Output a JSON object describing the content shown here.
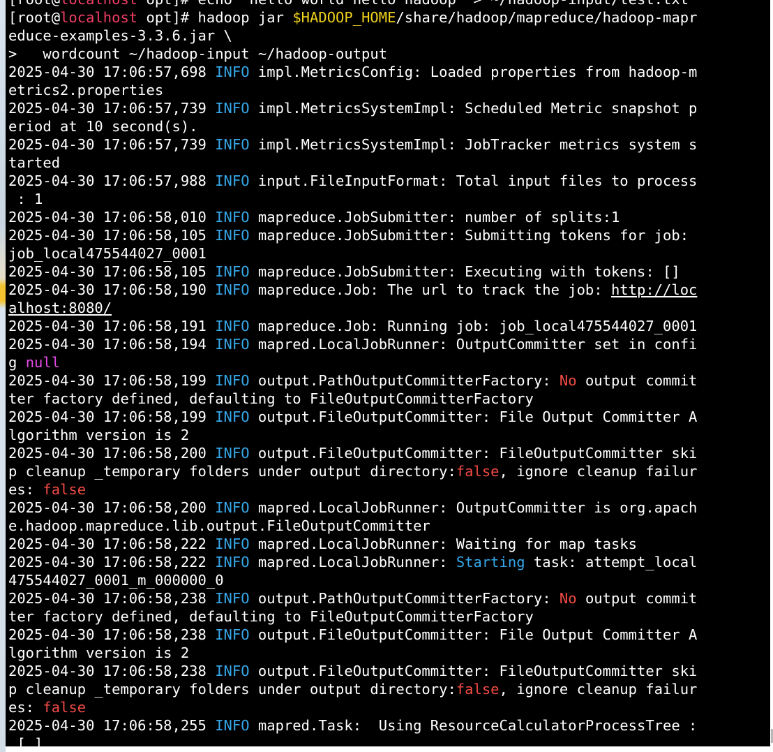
{
  "colors": {
    "terminal_background": "#000000",
    "text": "#ffffff",
    "hostname": "#f33f66",
    "info": "#36a7e8",
    "env_var": "#f0d21d",
    "null_value": "#e64be8",
    "false_value": "#f24b45",
    "no_value": "#f24b45"
  },
  "terminal": {
    "lines": [
      [
        {
          "t": "[root@",
          "c": ""
        },
        {
          "t": "localhost",
          "c": "red"
        },
        {
          "t": " opt]# echo \"hello world hello hadoop\" > ~/hadoop-input/test.txt",
          "c": ""
        }
      ],
      [
        {
          "t": "[root@",
          "c": ""
        },
        {
          "t": "localhost",
          "c": "red"
        },
        {
          "t": " opt]# hadoop jar ",
          "c": ""
        },
        {
          "t": "$HADOOP_HOME",
          "c": "env"
        },
        {
          "t": "/share/hadoop/mapreduce/hadoop-mapr",
          "c": ""
        }
      ],
      [
        {
          "t": "educe-examples-3.3.6.jar \\",
          "c": ""
        }
      ],
      [
        {
          "t": ">   wordcount ~/hadoop-input ~/hadoop-output",
          "c": ""
        }
      ],
      [
        {
          "t": "2025-04-30 17:06:57,698 ",
          "c": ""
        },
        {
          "t": "INFO",
          "c": "info"
        },
        {
          "t": " impl.MetricsConfig: Loaded properties from hadoop-m",
          "c": ""
        }
      ],
      [
        {
          "t": "etrics2.properties",
          "c": ""
        }
      ],
      [
        {
          "t": "2025-04-30 17:06:57,739 ",
          "c": ""
        },
        {
          "t": "INFO",
          "c": "info"
        },
        {
          "t": " impl.MetricsSystemImpl: Scheduled Metric snapshot p",
          "c": ""
        }
      ],
      [
        {
          "t": "eriod at 10 second(s).",
          "c": ""
        }
      ],
      [
        {
          "t": "2025-04-30 17:06:57,739 ",
          "c": ""
        },
        {
          "t": "INFO",
          "c": "info"
        },
        {
          "t": " impl.MetricsSystemImpl: JobTracker metrics system s",
          "c": ""
        }
      ],
      [
        {
          "t": "tarted",
          "c": ""
        }
      ],
      [
        {
          "t": "2025-04-30 17:06:57,988 ",
          "c": ""
        },
        {
          "t": "INFO",
          "c": "info"
        },
        {
          "t": " input.FileInputFormat: Total input files to process",
          "c": ""
        }
      ],
      [
        {
          "t": " : 1",
          "c": ""
        }
      ],
      [
        {
          "t": "2025-04-30 17:06:58,010 ",
          "c": ""
        },
        {
          "t": "INFO",
          "c": "info"
        },
        {
          "t": " mapreduce.JobSubmitter: number of splits:1",
          "c": ""
        }
      ],
      [
        {
          "t": "2025-04-30 17:06:58,105 ",
          "c": ""
        },
        {
          "t": "INFO",
          "c": "info"
        },
        {
          "t": " mapreduce.JobSubmitter: Submitting tokens for job:",
          "c": ""
        }
      ],
      [
        {
          "t": "job_local475544027_0001",
          "c": ""
        }
      ],
      [
        {
          "t": "2025-04-30 17:06:58,105 ",
          "c": ""
        },
        {
          "t": "INFO",
          "c": "info"
        },
        {
          "t": " mapreduce.JobSubmitter: Executing with tokens: []",
          "c": ""
        }
      ],
      [
        {
          "t": "2025-04-30 17:06:58,190 ",
          "c": ""
        },
        {
          "t": "INFO",
          "c": "info"
        },
        {
          "t": " mapreduce.Job: The url to track the job: ",
          "c": ""
        },
        {
          "t": "http://loc",
          "c": "link"
        }
      ],
      [
        {
          "t": "alhost:8080/",
          "c": "link"
        }
      ],
      [
        {
          "t": "2025-04-30 17:06:58,191 ",
          "c": ""
        },
        {
          "t": "INFO",
          "c": "info"
        },
        {
          "t": " mapreduce.Job: Running job: job_local475544027_0001",
          "c": ""
        }
      ],
      [
        {
          "t": "2025-04-30 17:06:58,194 ",
          "c": ""
        },
        {
          "t": "INFO",
          "c": "info"
        },
        {
          "t": " mapred.LocalJobRunner: OutputCommitter set in confi",
          "c": ""
        }
      ],
      [
        {
          "t": "g ",
          "c": ""
        },
        {
          "t": "null",
          "c": "magenta"
        }
      ],
      [
        {
          "t": "2025-04-30 17:06:58,199 ",
          "c": ""
        },
        {
          "t": "INFO",
          "c": "info"
        },
        {
          "t": " output.PathOutputCommitterFactory: ",
          "c": ""
        },
        {
          "t": "No",
          "c": "err"
        },
        {
          "t": " output commit",
          "c": ""
        }
      ],
      [
        {
          "t": "ter factory defined, defaulting to FileOutputCommitterFactory",
          "c": ""
        }
      ],
      [
        {
          "t": "2025-04-30 17:06:58,199 ",
          "c": ""
        },
        {
          "t": "INFO",
          "c": "info"
        },
        {
          "t": " output.FileOutputCommitter: File Output Committer A",
          "c": ""
        }
      ],
      [
        {
          "t": "lgorithm version is 2",
          "c": ""
        }
      ],
      [
        {
          "t": "2025-04-30 17:06:58,200 ",
          "c": ""
        },
        {
          "t": "INFO",
          "c": "info"
        },
        {
          "t": " output.FileOutputCommitter: FileOutputCommitter ski",
          "c": ""
        }
      ],
      [
        {
          "t": "p cleanup _temporary folders under output directory:",
          "c": ""
        },
        {
          "t": "false",
          "c": "err"
        },
        {
          "t": ", ignore cleanup failur",
          "c": ""
        }
      ],
      [
        {
          "t": "es: ",
          "c": ""
        },
        {
          "t": "false",
          "c": "err"
        }
      ],
      [
        {
          "t": "2025-04-30 17:06:58,200 ",
          "c": ""
        },
        {
          "t": "INFO",
          "c": "info"
        },
        {
          "t": " mapred.LocalJobRunner: OutputCommitter is org.apach",
          "c": ""
        }
      ],
      [
        {
          "t": "e.hadoop.mapreduce.lib.output.FileOutputCommitter",
          "c": ""
        }
      ],
      [
        {
          "t": "2025-04-30 17:06:58,222 ",
          "c": ""
        },
        {
          "t": "INFO",
          "c": "info"
        },
        {
          "t": " mapred.LocalJobRunner: Waiting for map tasks",
          "c": ""
        }
      ],
      [
        {
          "t": "2025-04-30 17:06:58,222 ",
          "c": ""
        },
        {
          "t": "INFO",
          "c": "info"
        },
        {
          "t": " mapred.LocalJobRunner: ",
          "c": ""
        },
        {
          "t": "Starting",
          "c": "start"
        },
        {
          "t": " task: attempt_local",
          "c": ""
        }
      ],
      [
        {
          "t": "475544027_0001_m_000000_0",
          "c": ""
        }
      ],
      [
        {
          "t": "2025-04-30 17:06:58,238 ",
          "c": ""
        },
        {
          "t": "INFO",
          "c": "info"
        },
        {
          "t": " output.PathOutputCommitterFactory: ",
          "c": ""
        },
        {
          "t": "No",
          "c": "err"
        },
        {
          "t": " output commit",
          "c": ""
        }
      ],
      [
        {
          "t": "ter factory defined, defaulting to FileOutputCommitterFactory",
          "c": ""
        }
      ],
      [
        {
          "t": "2025-04-30 17:06:58,238 ",
          "c": ""
        },
        {
          "t": "INFO",
          "c": "info"
        },
        {
          "t": " output.FileOutputCommitter: File Output Committer A",
          "c": ""
        }
      ],
      [
        {
          "t": "lgorithm version is 2",
          "c": ""
        }
      ],
      [
        {
          "t": "2025-04-30 17:06:58,238 ",
          "c": ""
        },
        {
          "t": "INFO",
          "c": "info"
        },
        {
          "t": " output.FileOutputCommitter: FileOutputCommitter ski",
          "c": ""
        }
      ],
      [
        {
          "t": "p cleanup _temporary folders under output directory:",
          "c": ""
        },
        {
          "t": "false",
          "c": "err"
        },
        {
          "t": ", ignore cleanup failur",
          "c": ""
        }
      ],
      [
        {
          "t": "es: ",
          "c": ""
        },
        {
          "t": "false",
          "c": "err"
        }
      ],
      [
        {
          "t": "2025-04-30 17:06:58,255 ",
          "c": ""
        },
        {
          "t": "INFO",
          "c": "info"
        },
        {
          "t": " mapred.Task:  Using ResourceCalculatorProcessTree :",
          "c": ""
        }
      ],
      [
        {
          "t": " [ ]",
          "c": ""
        }
      ]
    ]
  }
}
